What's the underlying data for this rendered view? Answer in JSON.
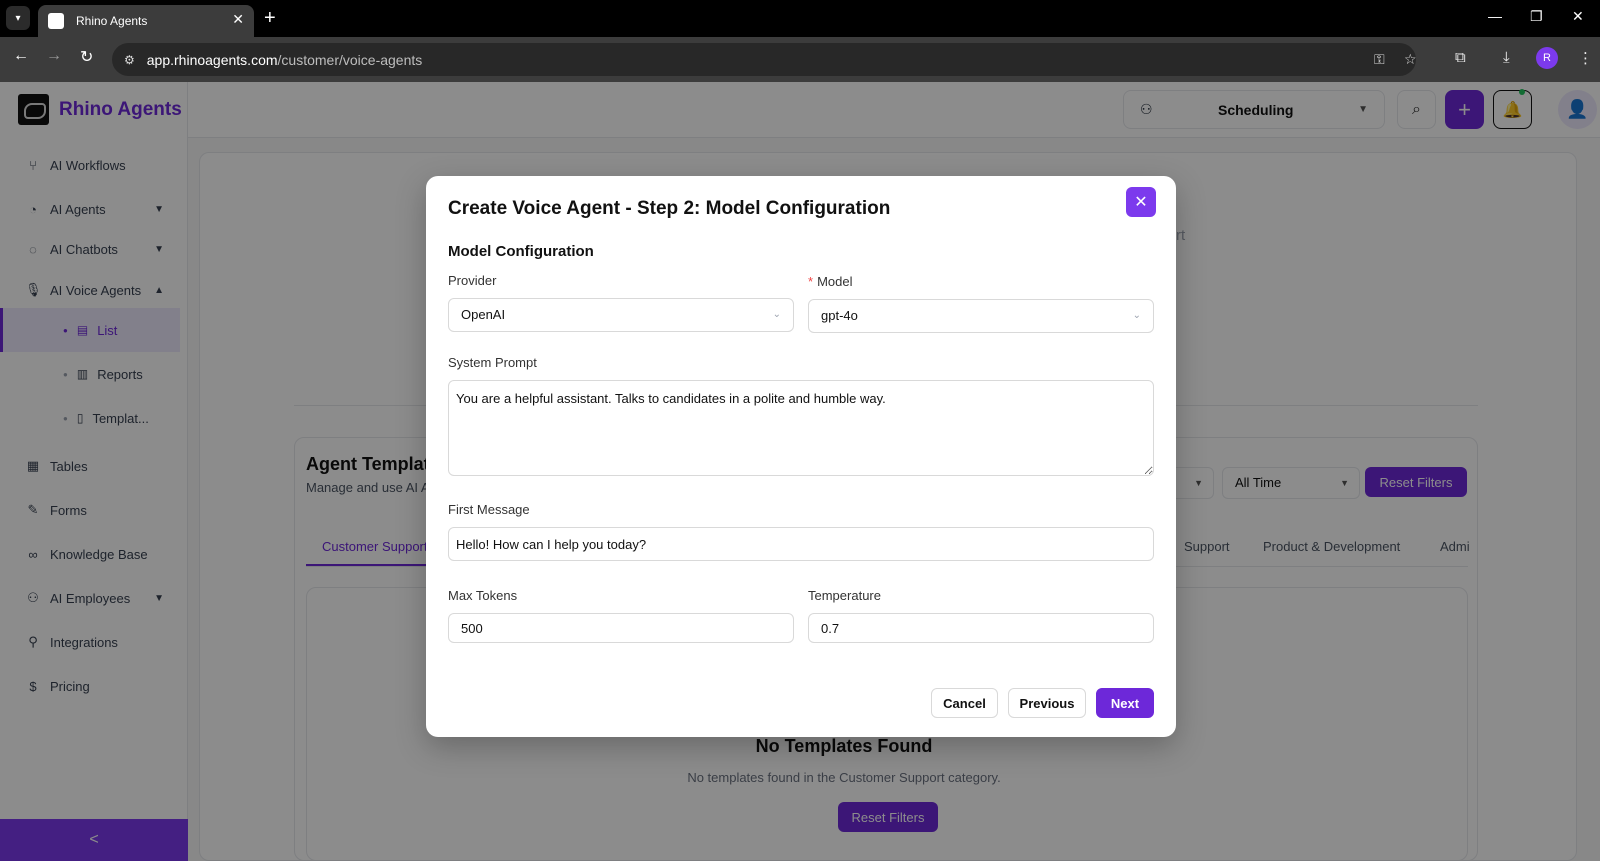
{
  "browser": {
    "tab_title": "Rhino Agents",
    "url_domain": "app.rhinoagents.com",
    "url_path": "/customer/voice-agents",
    "profile_initial": "R"
  },
  "sidebar": {
    "brand": "Rhino Agents",
    "items": [
      {
        "label": "AI Workflows",
        "icon": "workflow-icon"
      },
      {
        "label": "AI Agents",
        "icon": "agents-icon"
      },
      {
        "label": "AI Chatbots",
        "icon": "chatbot-icon"
      },
      {
        "label": "AI Voice Agents",
        "icon": "microphone-icon"
      },
      {
        "label": "Tables",
        "icon": "table-icon"
      },
      {
        "label": "Forms",
        "icon": "form-icon"
      },
      {
        "label": "Knowledge Base",
        "icon": "link-icon"
      },
      {
        "label": "AI Employees",
        "icon": "employees-icon"
      },
      {
        "label": "Integrations",
        "icon": "plug-icon"
      },
      {
        "label": "Pricing",
        "icon": "dollar-icon"
      }
    ],
    "sub_items": [
      {
        "label": "List"
      },
      {
        "label": "Reports"
      },
      {
        "label": "Templat..."
      }
    ],
    "collapse_glyph": "<"
  },
  "topbar": {
    "workspace": "Scheduling"
  },
  "background": {
    "ghost_text": "rt",
    "templates_title": "Agent Templat",
    "templates_subtitle": "Manage and use AI A",
    "filter_time": "All Time",
    "reset_filters": "Reset Filters",
    "tabs": [
      "Customer Support",
      "Support",
      "Product & Development",
      "Admi"
    ],
    "empty_title": "No Templates Found",
    "empty_subtitle": "No templates found in the Customer Support category.",
    "empty_reset": "Reset Filters"
  },
  "modal": {
    "title": "Create Voice Agent - Step 2: Model Configuration",
    "section": "Model Configuration",
    "provider_label": "Provider",
    "provider_value": "OpenAI",
    "model_label": "Model",
    "model_value": "gpt-4o",
    "system_prompt_label": "System Prompt",
    "system_prompt_value": "You are a helpful assistant. Talks to candidates in a polite and humble way.",
    "first_message_label": "First Message",
    "first_message_value": "Hello! How can I help you today?",
    "max_tokens_label": "Max Tokens",
    "max_tokens_value": "500",
    "temperature_label": "Temperature",
    "temperature_value": "0.7",
    "cancel": "Cancel",
    "previous": "Previous",
    "next": "Next"
  },
  "colors": {
    "brand": "#6d28d9",
    "accent": "#7c3aed"
  }
}
